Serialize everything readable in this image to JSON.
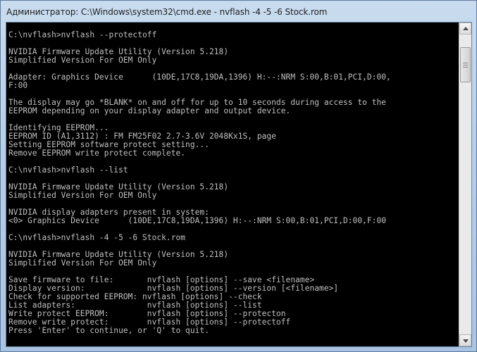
{
  "window": {
    "title": "Администратор: C:\\Windows\\system32\\cmd.exe - nvflash  -4 -5 -6 Stock.rom"
  },
  "console": {
    "lines": [
      "",
      "C:\\nvflash>nvflash --protectoff",
      "",
      "NVIDIA Firmware Update Utility (Version 5.218)",
      "Simplified Version For OEM Only",
      "",
      "Adapter: Graphics Device      (10DE,17C8,19DA,1396) H:--:NRM S:00,B:01,PCI,D:00,",
      "F:00",
      "",
      "The display may go *BLANK* on and off for up to 10 seconds during access to the",
      "EEPROM depending on your display adapter and output device.",
      "",
      "Identifying EEPROM...",
      "EEPROM ID (A1,3112) : FM FM25F02 2.7-3.6V 2048Kx1S, page",
      "Setting EEPROM software protect setting...",
      "Remove EEPROM write protect complete.",
      "",
      "C:\\nvflash>nvflash --list",
      "",
      "NVIDIA Firmware Update Utility (Version 5.218)",
      "Simplified Version For OEM Only",
      "",
      "NVIDIA display adapters present in system:",
      "<0> Graphics Device      (10DE,17C8,19DA,1396) H:--:NRM S:00,B:01,PCI,D:00,F:00",
      "",
      "C:\\nvflash>nvflash -4 -5 -6 Stock.rom",
      "",
      "NVIDIA Firmware Update Utility (Version 5.218)",
      "Simplified Version For OEM Only",
      "",
      "Save firmware to file:       nvflash [options] --save <filename>",
      "Display version:             nvflash [options] --version [<filename>]",
      "Check for supported EEPROM: nvflash [options] --check",
      "List adapters:               nvflash [options] --list",
      "Write protect EEPROM:        nvflash [options] --protecton",
      "Remove write protect:        nvflash [options] --protectoff",
      "Press 'Enter' to continue, or 'Q' to quit."
    ]
  },
  "colors": {
    "console_bg": "#000000",
    "console_fg": "#c0c0c0"
  }
}
